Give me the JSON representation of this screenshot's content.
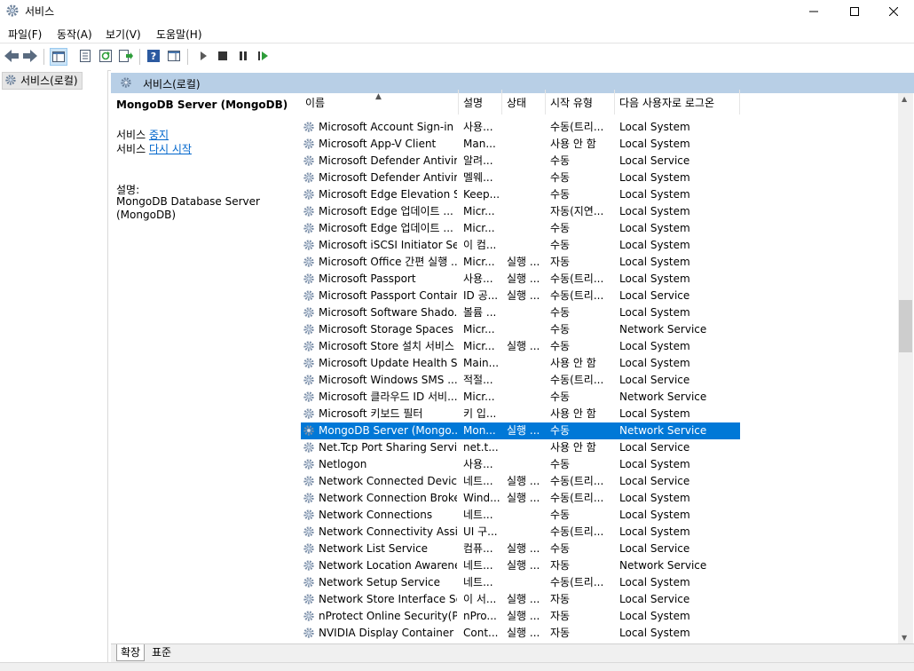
{
  "window": {
    "title": "서비스"
  },
  "menu": [
    "파일(F)",
    "동작(A)",
    "보기(V)",
    "도움말(H)"
  ],
  "tree": {
    "root": "서비스(로컬)"
  },
  "pane": {
    "header": "서비스(로컬)",
    "selected_service": "MongoDB Server (MongoDB)",
    "action_prefix_1": "서비스 ",
    "action_link_1": "중지",
    "action_prefix_2": "서비스 ",
    "action_link_2": "다시 시작",
    "desc_label": "설명:",
    "desc_line1": "MongoDB Database Server",
    "desc_line2": "(MongoDB)"
  },
  "columns": {
    "name": "이름",
    "desc": "설명",
    "status": "상태",
    "start": "시작 유형",
    "logon": "다음 사용자로 로그온"
  },
  "rows": [
    {
      "name": "Microsoft Account Sign-in ...",
      "desc": "사용...",
      "status": "",
      "start": "수동(트리...",
      "logon": "Local System"
    },
    {
      "name": "Microsoft App-V Client",
      "desc": "Man...",
      "status": "",
      "start": "사용 안 함",
      "logon": "Local System"
    },
    {
      "name": "Microsoft Defender Antivir...",
      "desc": "알려...",
      "status": "",
      "start": "수동",
      "logon": "Local Service"
    },
    {
      "name": "Microsoft Defender Antivir...",
      "desc": "멜웨...",
      "status": "",
      "start": "수동",
      "logon": "Local System"
    },
    {
      "name": "Microsoft Edge Elevation S...",
      "desc": "Keep...",
      "status": "",
      "start": "수동",
      "logon": "Local System"
    },
    {
      "name": "Microsoft Edge 업데이트 ...",
      "desc": "Micr...",
      "status": "",
      "start": "자동(지연...",
      "logon": "Local System"
    },
    {
      "name": "Microsoft Edge 업데이트 ...",
      "desc": "Micr...",
      "status": "",
      "start": "수동",
      "logon": "Local System"
    },
    {
      "name": "Microsoft iSCSI Initiator Se...",
      "desc": "이 컴...",
      "status": "",
      "start": "수동",
      "logon": "Local System"
    },
    {
      "name": "Microsoft Office 간편 실행 ...",
      "desc": "Micr...",
      "status": "실행 ...",
      "start": "자동",
      "logon": "Local System"
    },
    {
      "name": "Microsoft Passport",
      "desc": "사용...",
      "status": "실행 ...",
      "start": "수동(트리...",
      "logon": "Local System"
    },
    {
      "name": "Microsoft Passport Container",
      "desc": "ID 공...",
      "status": "실행 ...",
      "start": "수동(트리...",
      "logon": "Local Service"
    },
    {
      "name": "Microsoft Software Shado...",
      "desc": "볼륨 ...",
      "status": "",
      "start": "수동",
      "logon": "Local System"
    },
    {
      "name": "Microsoft Storage Spaces ...",
      "desc": "Micr...",
      "status": "",
      "start": "수동",
      "logon": "Network Service"
    },
    {
      "name": "Microsoft Store 설치 서비스",
      "desc": "Micr...",
      "status": "실행 ...",
      "start": "수동",
      "logon": "Local System"
    },
    {
      "name": "Microsoft Update Health S...",
      "desc": "Main...",
      "status": "",
      "start": "사용 안 함",
      "logon": "Local System"
    },
    {
      "name": "Microsoft Windows SMS ...",
      "desc": "적절...",
      "status": "",
      "start": "수동(트리...",
      "logon": "Local Service"
    },
    {
      "name": "Microsoft 클라우드 ID 서비...",
      "desc": "Micr...",
      "status": "",
      "start": "수동",
      "logon": "Network Service"
    },
    {
      "name": "Microsoft 키보드 필터",
      "desc": "키 입...",
      "status": "",
      "start": "사용 안 함",
      "logon": "Local System"
    },
    {
      "name": "MongoDB Server (Mongo...",
      "desc": "Mon...",
      "status": "실행 ...",
      "start": "수동",
      "logon": "Network Service",
      "selected": true
    },
    {
      "name": "Net.Tcp Port Sharing Service",
      "desc": "net.t...",
      "status": "",
      "start": "사용 안 함",
      "logon": "Local Service"
    },
    {
      "name": "Netlogon",
      "desc": "사용...",
      "status": "",
      "start": "수동",
      "logon": "Local System"
    },
    {
      "name": "Network Connected Device...",
      "desc": "네트...",
      "status": "실행 ...",
      "start": "수동(트리...",
      "logon": "Local Service"
    },
    {
      "name": "Network Connection Broker",
      "desc": "Wind...",
      "status": "실행 ...",
      "start": "수동(트리...",
      "logon": "Local System"
    },
    {
      "name": "Network Connections",
      "desc": "네트...",
      "status": "",
      "start": "수동",
      "logon": "Local System"
    },
    {
      "name": "Network Connectivity Assis...",
      "desc": "UI 구...",
      "status": "",
      "start": "수동(트리...",
      "logon": "Local System"
    },
    {
      "name": "Network List Service",
      "desc": "컴퓨...",
      "status": "실행 ...",
      "start": "수동",
      "logon": "Local Service"
    },
    {
      "name": "Network Location Awareness",
      "desc": "네트...",
      "status": "실행 ...",
      "start": "자동",
      "logon": "Network Service"
    },
    {
      "name": "Network Setup Service",
      "desc": "네트...",
      "status": "",
      "start": "수동(트리...",
      "logon": "Local System"
    },
    {
      "name": "Network Store Interface Se...",
      "desc": "이 서...",
      "status": "실행 ...",
      "start": "자동",
      "logon": "Local Service"
    },
    {
      "name": "nProtect Online Security(P...",
      "desc": "nPro...",
      "status": "실행 ...",
      "start": "자동",
      "logon": "Local System"
    },
    {
      "name": "NVIDIA Display Container LS",
      "desc": "Cont...",
      "status": "실행 ...",
      "start": "자동",
      "logon": "Local System"
    }
  ],
  "tabs": [
    "확장",
    "표준"
  ]
}
